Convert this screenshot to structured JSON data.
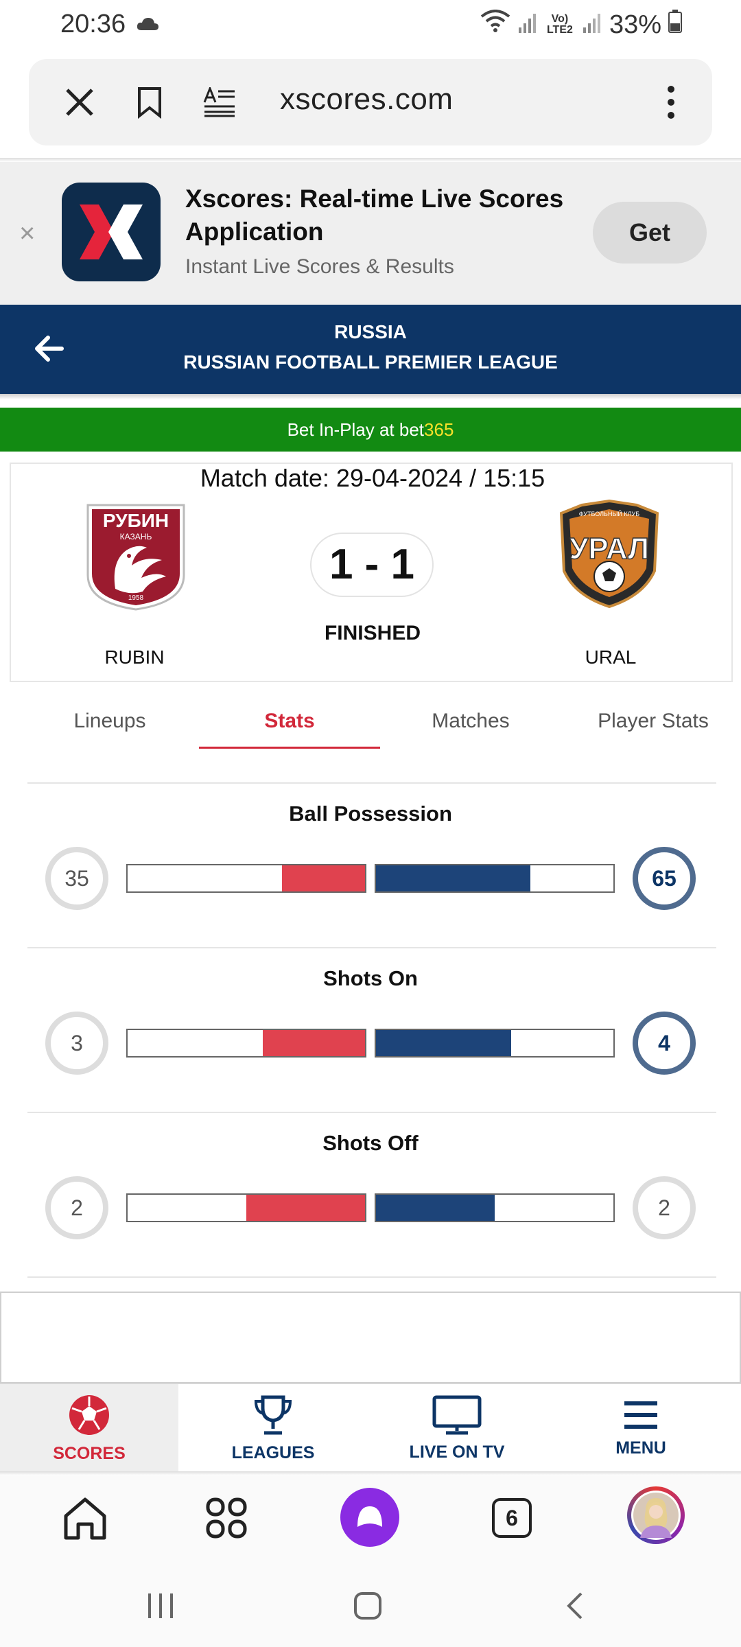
{
  "status_bar": {
    "time": "20:36",
    "network_label": "Vo) LTE2",
    "battery": "33%"
  },
  "browser": {
    "url": "xscores.com",
    "icons": [
      "close-icon",
      "bookmark-icon",
      "reader-mode-icon",
      "more-vert-icon"
    ]
  },
  "app_banner": {
    "title": "Xscores: Real-time Live Scores Application",
    "subtitle": "Instant Live Scores & Results",
    "get_label": "Get",
    "close_glyph": "×"
  },
  "league": {
    "country": "RUSSIA",
    "name": "RUSSIAN FOOTBALL PREMIER LEAGUE"
  },
  "bet_bar": {
    "text": "Bet In-Play at bet",
    "brand_suffix": "365",
    "brand_color": "#f5e12a",
    "background": "#128a12"
  },
  "match": {
    "date_label": "Match date: 29-04-2024 / 15:15",
    "score": "1 - 1",
    "status": "FINISHED",
    "home": {
      "name": "RUBIN",
      "logo_text": "РУБИН",
      "logo_sub": "КАЗАНЬ",
      "logo_year": "1958"
    },
    "away": {
      "name": "URAL",
      "logo_text": "УРАЛ",
      "logo_sub": "ФУТБОЛЬНЫЙ КЛУБ"
    }
  },
  "tabs": [
    {
      "label": "Lineups",
      "active": false
    },
    {
      "label": "Stats",
      "active": true
    },
    {
      "label": "Matches",
      "active": false
    },
    {
      "label": "Player Stats",
      "active": false
    }
  ],
  "stats": [
    {
      "title": "Ball Possession",
      "home": "35",
      "away": "65",
      "home_fraction": 0.35,
      "away_fraction": 0.65,
      "winner": "away"
    },
    {
      "title": "Shots On",
      "home": "3",
      "away": "4",
      "home_fraction": 0.43,
      "away_fraction": 0.57,
      "winner": "away"
    },
    {
      "title": "Shots Off",
      "home": "2",
      "away": "2",
      "home_fraction": 0.5,
      "away_fraction": 0.5,
      "winner": "none"
    }
  ],
  "site_nav": [
    {
      "label": "SCORES",
      "icon": "soccer-ball-icon",
      "active": true
    },
    {
      "label": "LEAGUES",
      "icon": "trophy-icon",
      "active": false
    },
    {
      "label": "LIVE ON TV",
      "icon": "tv-icon",
      "active": false
    },
    {
      "label": "MENU",
      "icon": "hamburger-menu-icon",
      "active": false
    }
  ],
  "browser_toolbar": {
    "tab_count": "6",
    "icons": [
      "home-icon",
      "apps-grid-icon",
      "assistant-icon",
      "tabs-icon",
      "profile-avatar-icon"
    ]
  },
  "colors": {
    "navy": "#0d3566",
    "accent_red": "#d2283a",
    "home_bar": "#e0424f",
    "away_bar": "#1d4479"
  }
}
